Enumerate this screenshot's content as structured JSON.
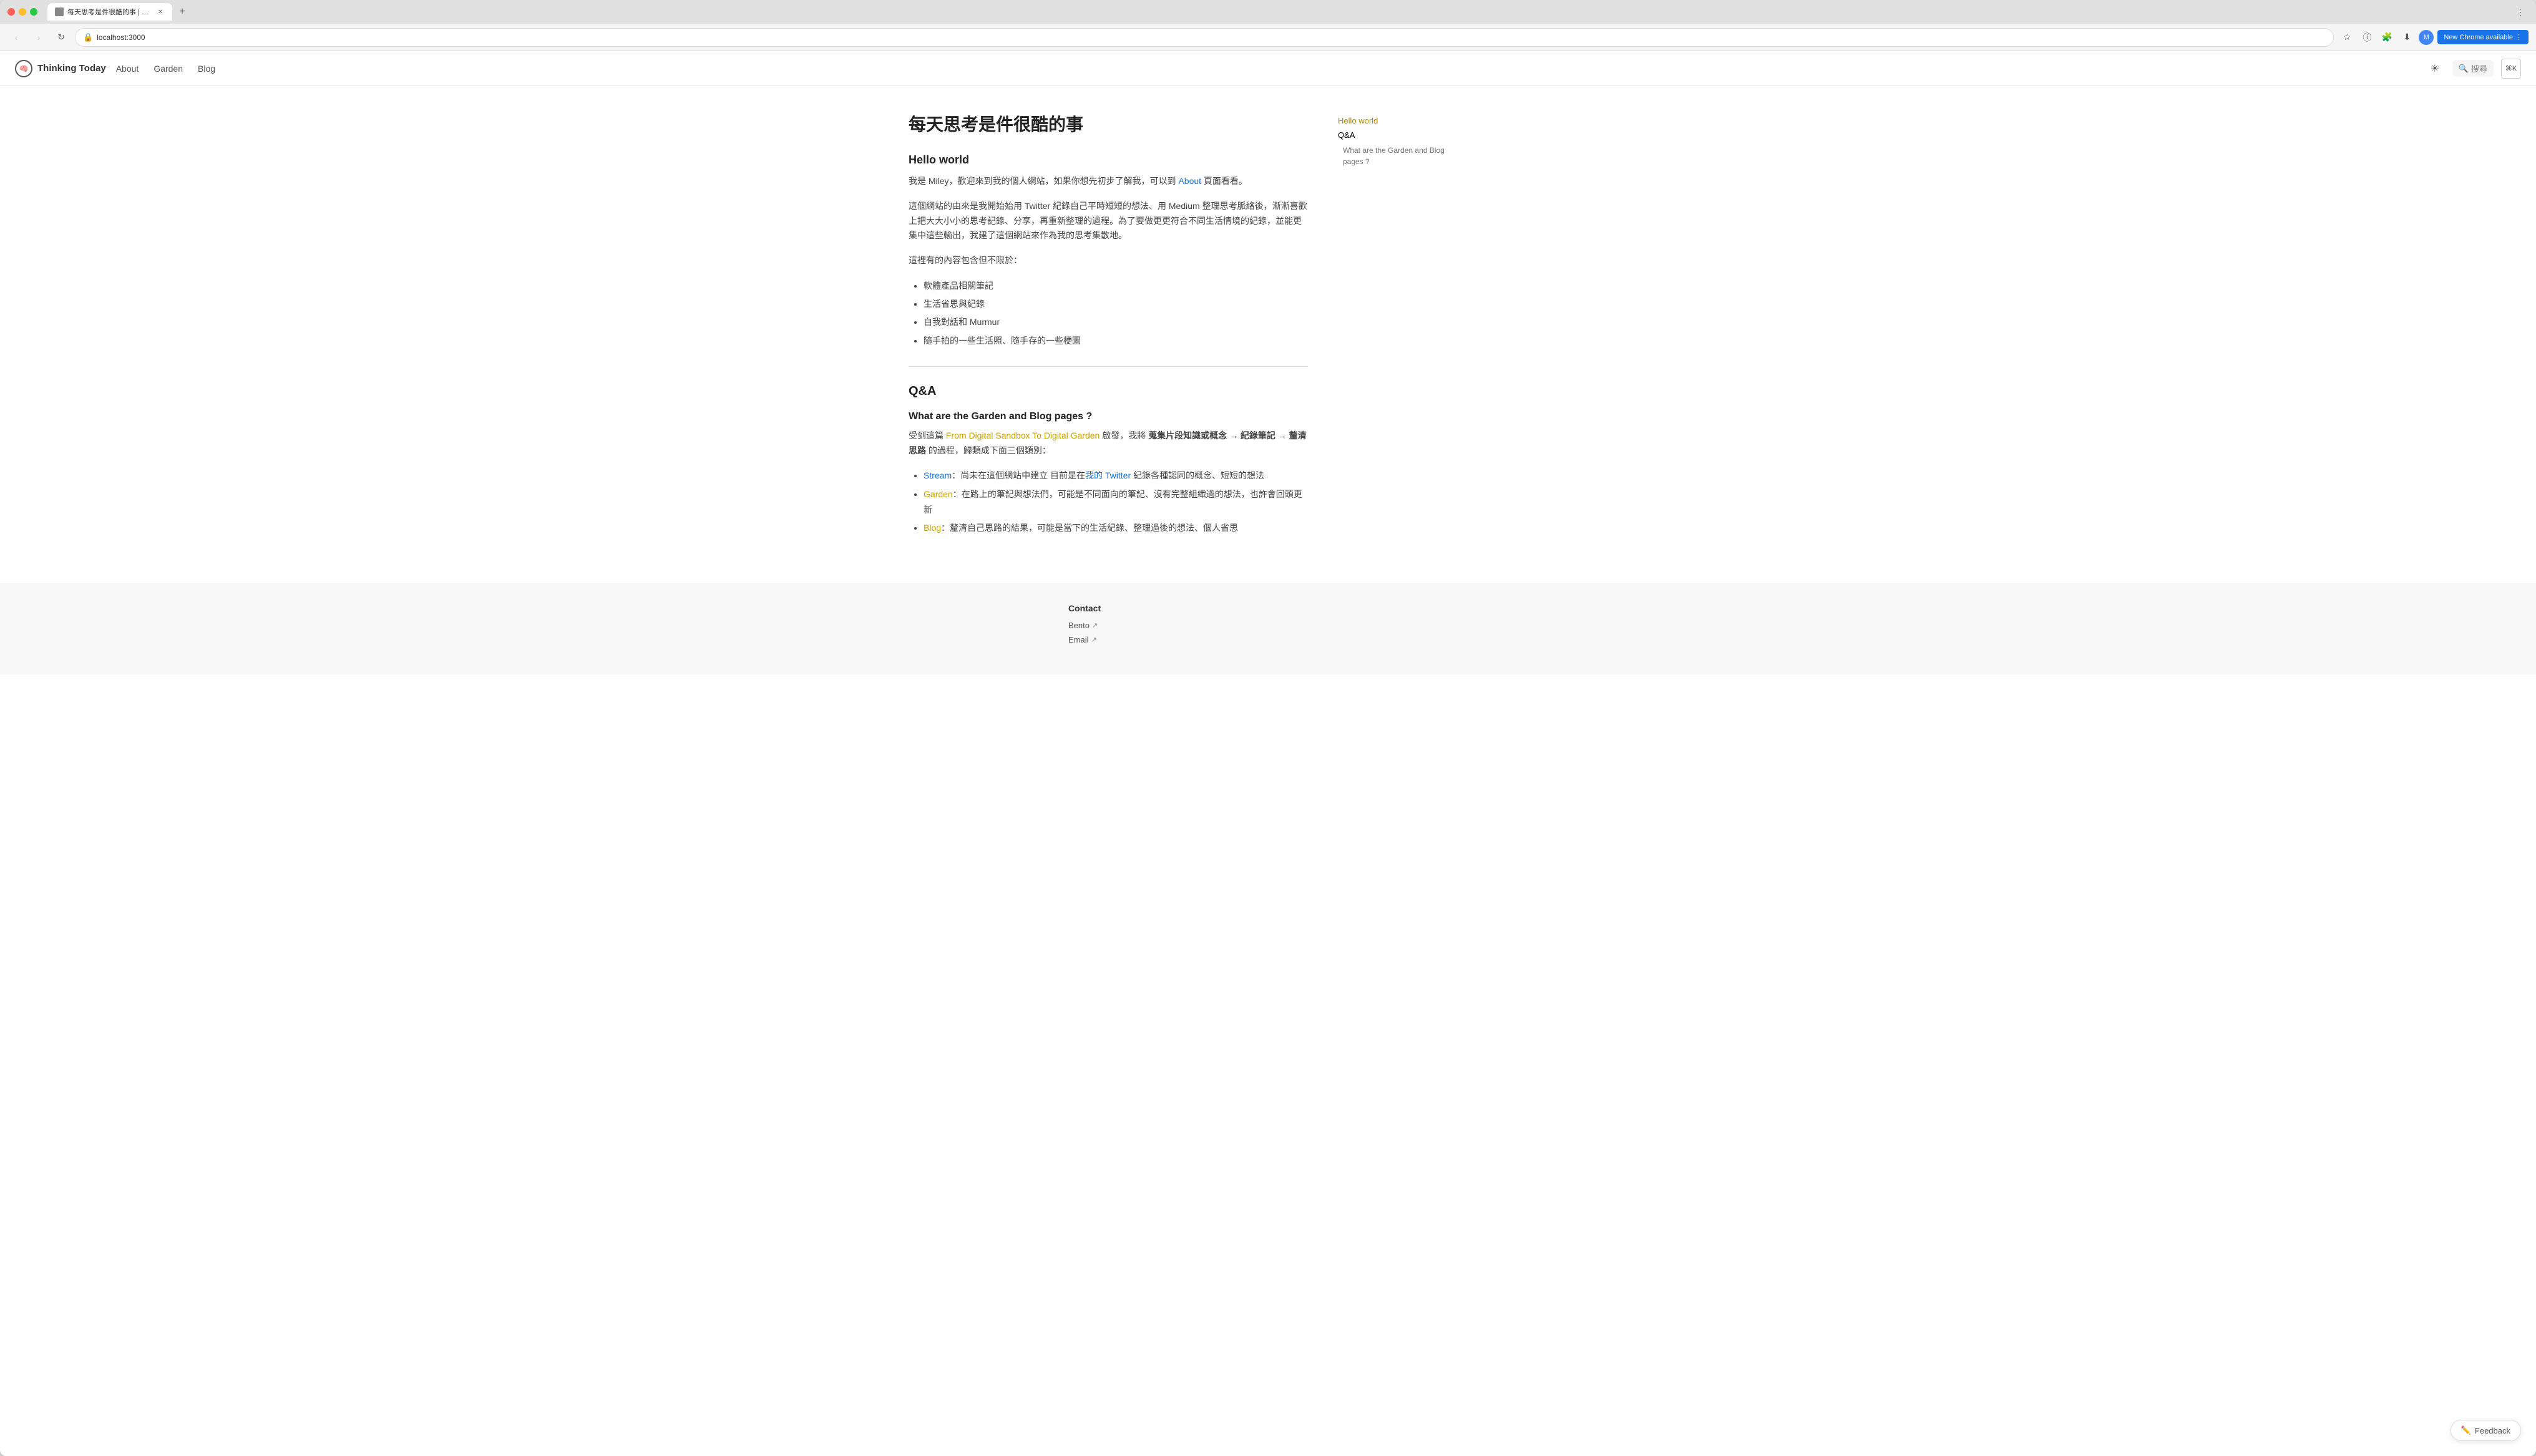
{
  "browser": {
    "tab_title": "每天思考是件很酷的事 | Think...",
    "tab_favicon": "🧠",
    "new_tab_label": "+",
    "url": "localhost:3000",
    "update_btn_label": "New Chrome available",
    "nav": {
      "back_disabled": true,
      "forward_disabled": true
    }
  },
  "site": {
    "logo_icon": "🧠",
    "logo_text": "Thinking Today",
    "nav_items": [
      "About",
      "Garden",
      "Blog"
    ],
    "search_placeholder": "搜尋"
  },
  "page": {
    "title": "每天思考是件很酷的事",
    "hello_world_heading": "Hello world",
    "intro_p1": "我是 Miley，歡迎來到我的個人網站，如果你想先初步了解我，可以到 About 頁面看看。",
    "intro_p2": "這個網站的由來是我開始始用 Twitter 紀錄自己平時短短的想法、用 Medium 整理思考脈絡後，漸漸喜歡上把大大小小的思考記錄、分享，再重新整理的過程。為了要做更更符合不同生活情境的紀錄，並能更集中這些輸出，我建了這個網站來作為我的思考集散地。",
    "intro_p3": "這裡有的內容包含但不限於：",
    "bullet_items": [
      "軟體產品相關筆記",
      "生活省思與紀錄",
      "自我對話和 Murmur",
      "隨手拍的一些生活照、隨手存的一些梗圖"
    ],
    "qa_heading": "Q&A",
    "qa_subheading": "What are the Garden and Blog pages ?",
    "qa_p1_prefix": "受到這篇 ",
    "qa_p1_link_text": "From Digital Sandbox To Digital Garden",
    "qa_p1_suffix": " 啟發，我將 蒐集片段知識或概念 → 紀錄筆記 → 釐清思路 的過程，歸類成下面三個類別：",
    "qa_bold_text": "蒐集片段知識或概念 → 紀錄筆記 → 釐清思路",
    "qa_bullets": [
      {
        "label": "Stream",
        "label_style": "stream",
        "text": "：尚未在這個網站中建立 目前是在我的 Twitter 紀錄各種認同的概念、短短的想法"
      },
      {
        "label": "Garden",
        "label_style": "garden",
        "text": "：在路上的筆記與想法們，可能是不同面向的筆記、沒有完整組織過的想法，也許會回頭更新"
      },
      {
        "label": "Blog",
        "label_style": "blog",
        "text": "：釐清自己思路的結果，可能是當下的生活紀錄、整理過後的想法、個人省思"
      }
    ]
  },
  "toc": {
    "items": [
      {
        "label": "Hello world",
        "style": "main"
      },
      {
        "label": "Q&A",
        "style": "normal"
      },
      {
        "label": "What are the Garden and Blog pages ?",
        "style": "sub"
      }
    ]
  },
  "footer": {
    "contact_label": "Contact",
    "links": [
      {
        "label": "Bento",
        "icon": "↗"
      },
      {
        "label": "Email",
        "icon": "↗"
      }
    ]
  },
  "feedback": {
    "label": "Feedback",
    "icon": "✏️"
  }
}
